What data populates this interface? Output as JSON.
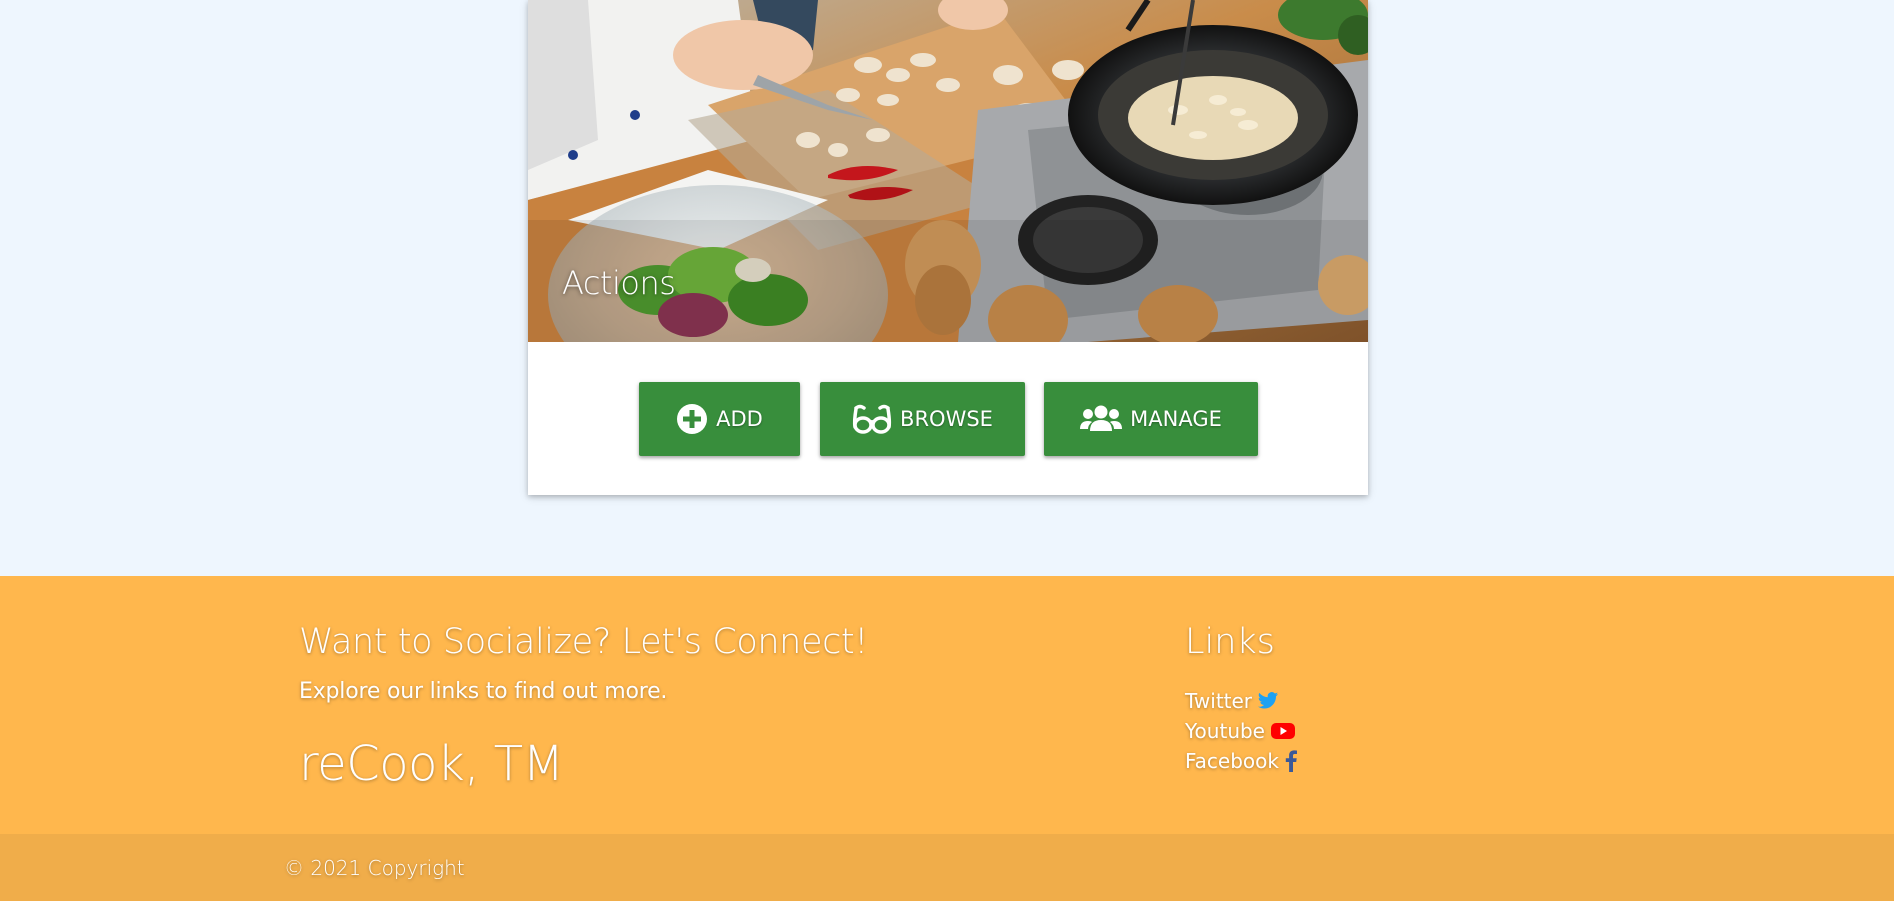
{
  "card": {
    "title": "Actions",
    "image_alt": "chef chopping mushrooms beside a frying pan and salad bowl"
  },
  "actions": {
    "add_label": "Add",
    "browse_label": "Browse",
    "manage_label": "Manage"
  },
  "footer": {
    "heading": "Want to Socialize? Let's Connect!",
    "subtext": "Explore our links to find out more.",
    "brand": "reCook, TM",
    "links_heading": "Links",
    "links": [
      {
        "label": "Twitter",
        "icon": "twitter-icon",
        "color": "#1da1f2"
      },
      {
        "label": "Youtube",
        "icon": "youtube-icon",
        "color": "#ff0000"
      },
      {
        "label": "Facebook",
        "icon": "facebook-icon",
        "color": "#3b5998"
      }
    ],
    "copyright": "© 2021 Copyright"
  },
  "colors": {
    "page_background": "#eef6fe",
    "button": "#388e3c",
    "footer": "#ffb74d",
    "footer_copyright": "#f0ad4a"
  }
}
